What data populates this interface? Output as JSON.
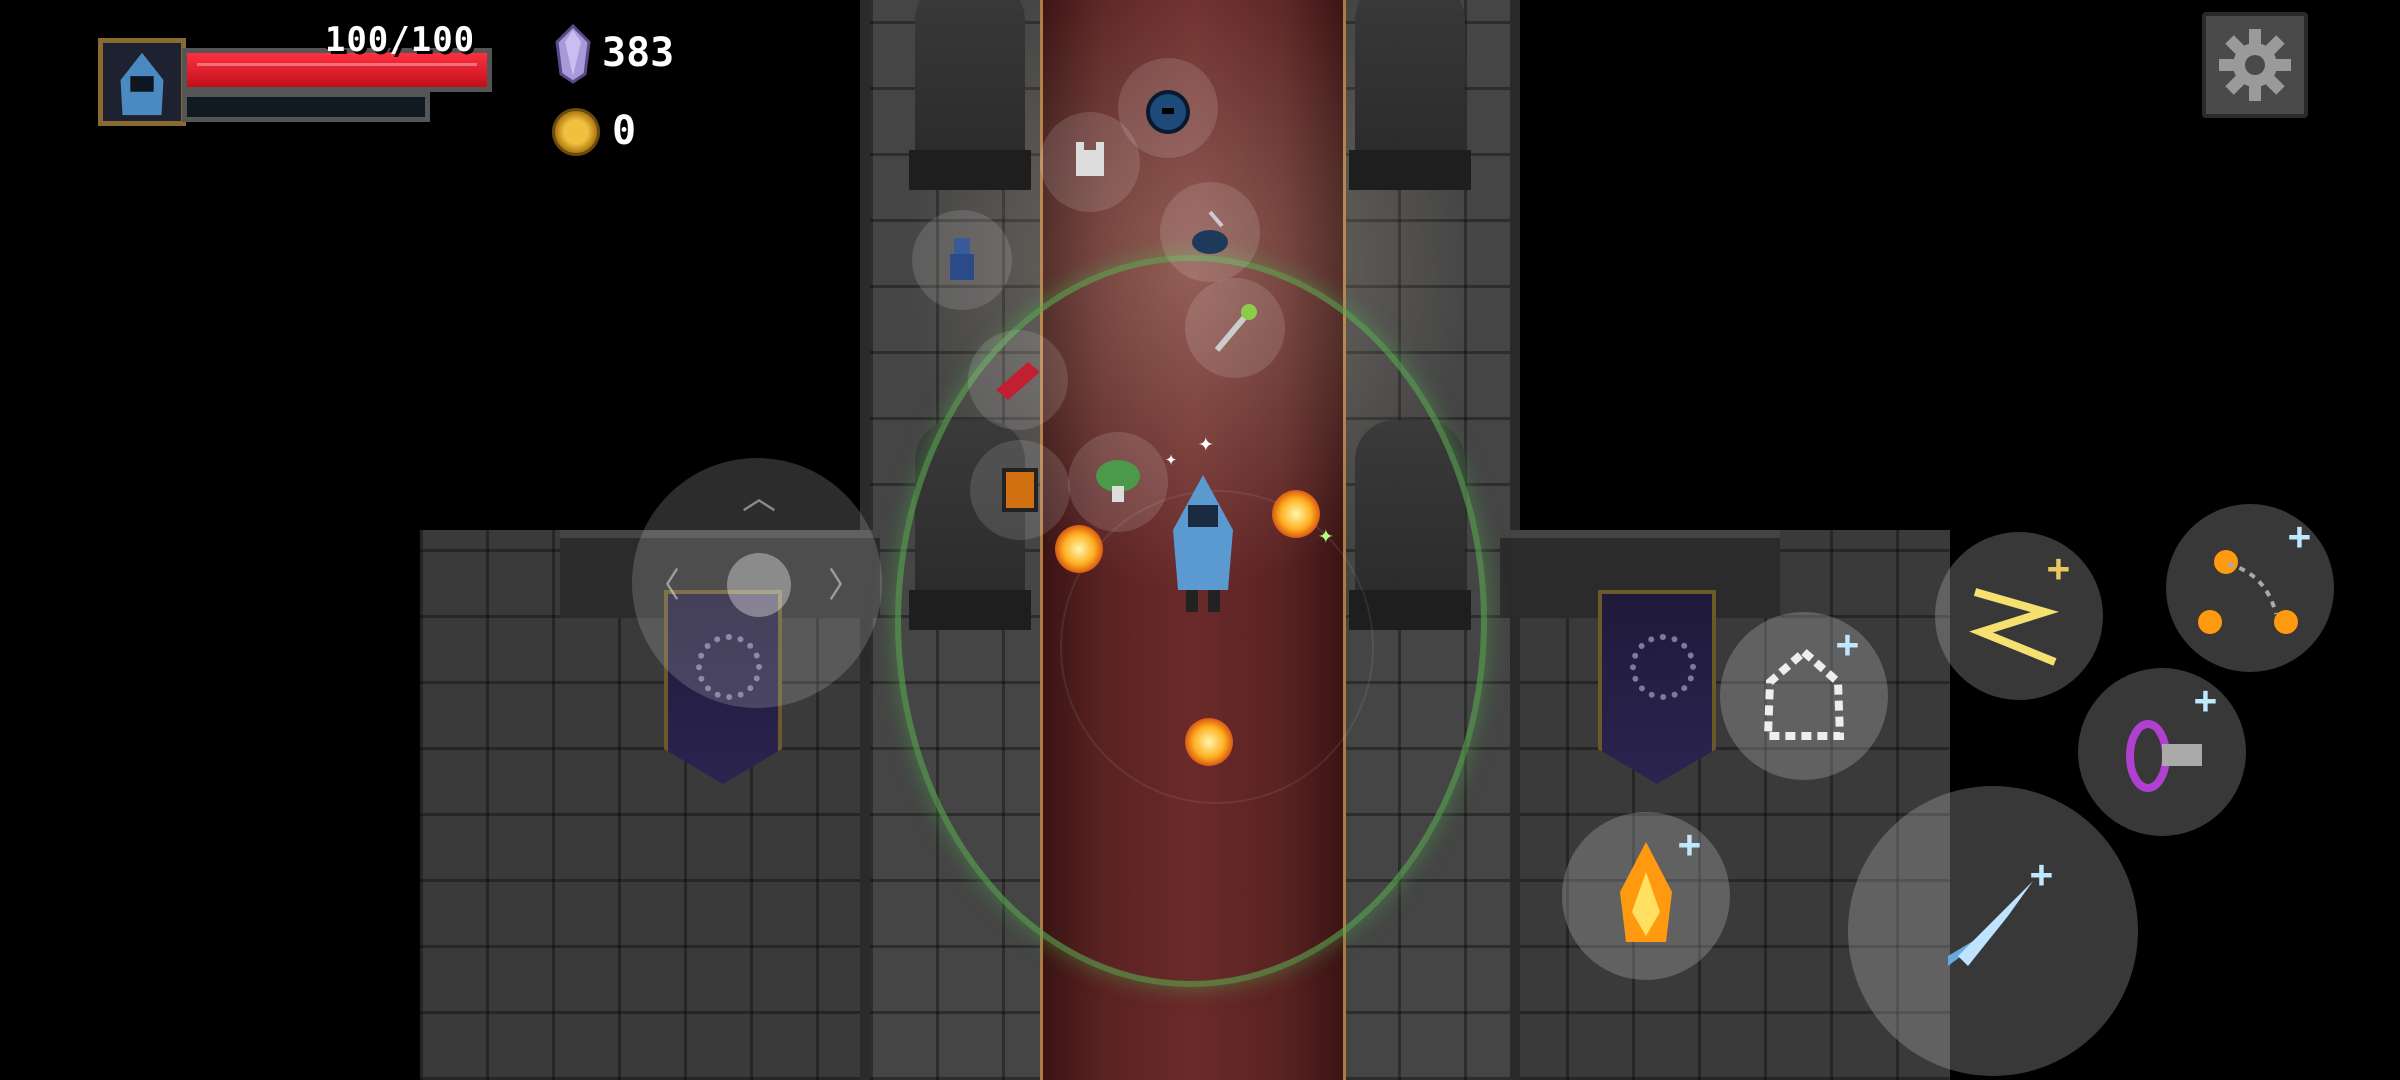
{
  "hud": {
    "portrait_icon": "hooded-wizard-portrait-icon",
    "health": {
      "current": 100,
      "max": 100,
      "text": "100/100",
      "fraction": 1.0,
      "color": "#e0202e"
    },
    "mana": {
      "fraction": 0.0,
      "color": "#3aa0e0"
    },
    "gems": {
      "icon": "purple-gem-icon",
      "count": "383"
    },
    "gold": {
      "icon": "gold-coin-icon",
      "count": "0"
    },
    "settings_icon": "gear-icon"
  },
  "controls": {
    "joystick_icon": "dpad-joystick",
    "skills": [
      {
        "name": "basic-attack",
        "icon": "ice-shard-icon"
      },
      {
        "name": "fire-skill",
        "icon": "fire-burst-icon"
      },
      {
        "name": "summon-skill",
        "icon": "ghost-summon-icon"
      },
      {
        "name": "lightning-skill",
        "icon": "lightning-chain-icon"
      },
      {
        "name": "portal-dash",
        "icon": "portal-dash-icon"
      },
      {
        "name": "fireball-chain",
        "icon": "fireball-chain-icon"
      }
    ]
  },
  "colors": {
    "accent_green_aura": "#5aaa50",
    "carpet": "#5a2222"
  }
}
